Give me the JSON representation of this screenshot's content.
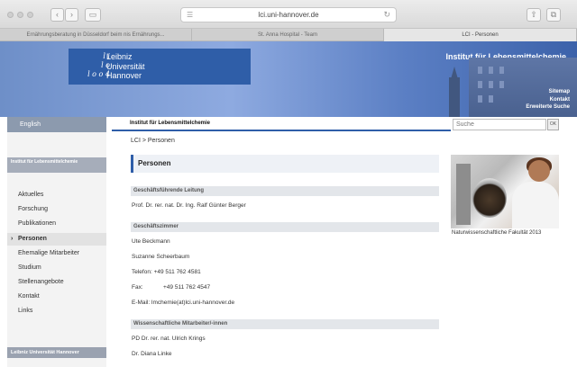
{
  "browser": {
    "url": "lci.uni-hannover.de",
    "tabs": [
      {
        "label": "Ernährungsberatung in Düsseldorf beim nis Ernährungs..."
      },
      {
        "label": "St. Anna Hospital - Team"
      },
      {
        "label": "LCI - Personen"
      }
    ],
    "icons": {
      "back": "‹",
      "forward": "›",
      "sidebar": "▭",
      "reader": "☰",
      "reload": "↻",
      "share": "⇧",
      "new_tab": "⧉"
    }
  },
  "header": {
    "logo_lines": [
      "Leibniz",
      "Universität",
      "Hannover"
    ],
    "logo_mark": [
      "l i",
      "l o",
      "l o o 4"
    ],
    "institute_title": "Institut für Lebensmittelchemie",
    "links": [
      "Sitemap",
      "Kontakt",
      "Erweiterte Suche"
    ]
  },
  "subbar": {
    "language": "English",
    "crumb_label": "Institut für Lebensmittelchemie",
    "search_placeholder": "Suche",
    "search_button": "OK"
  },
  "leftnav": {
    "heading": "Institut für Lebensmittelchemie",
    "items": [
      {
        "label": "Aktuelles"
      },
      {
        "label": "Forschung"
      },
      {
        "label": "Publikationen"
      },
      {
        "label": "Personen",
        "active": true
      },
      {
        "label": "Ehemalige Mitarbeiter"
      },
      {
        "label": "Studium"
      },
      {
        "label": "Stellenangebote"
      },
      {
        "label": "Kontakt"
      },
      {
        "label": "Links"
      }
    ],
    "footer": "Leibniz Universität Hannover"
  },
  "main": {
    "breadcrumb": "LCI > Personen",
    "title": "Personen",
    "sections": [
      {
        "heading": "Geschäftsführende Leitung"
      },
      {
        "heading": "Geschäftszimmer"
      },
      {
        "heading": "Wissenschaftliche Mitarbeiter/-innen"
      }
    ],
    "leitung_name": "Prof. Dr. rer. nat. Dr. Ing. Ralf Günter Berger",
    "office": {
      "person1": "Ute Beckmann",
      "person2": "Suzanne Scheerbaum",
      "phone": "Telefon: +49 511 762 4581",
      "fax_label": "Fax:",
      "fax_number": "+49 511 762 4547",
      "email": "E-Mail: lmchemie(at)lci.uni-hannover.de"
    },
    "staff": [
      "PD Dr. rer. nat. Ulrich Krings",
      "Dr. Diana Linke"
    ]
  },
  "sidebar_image": {
    "caption": "Naturwissenschaftliche Fakultät 2013"
  }
}
